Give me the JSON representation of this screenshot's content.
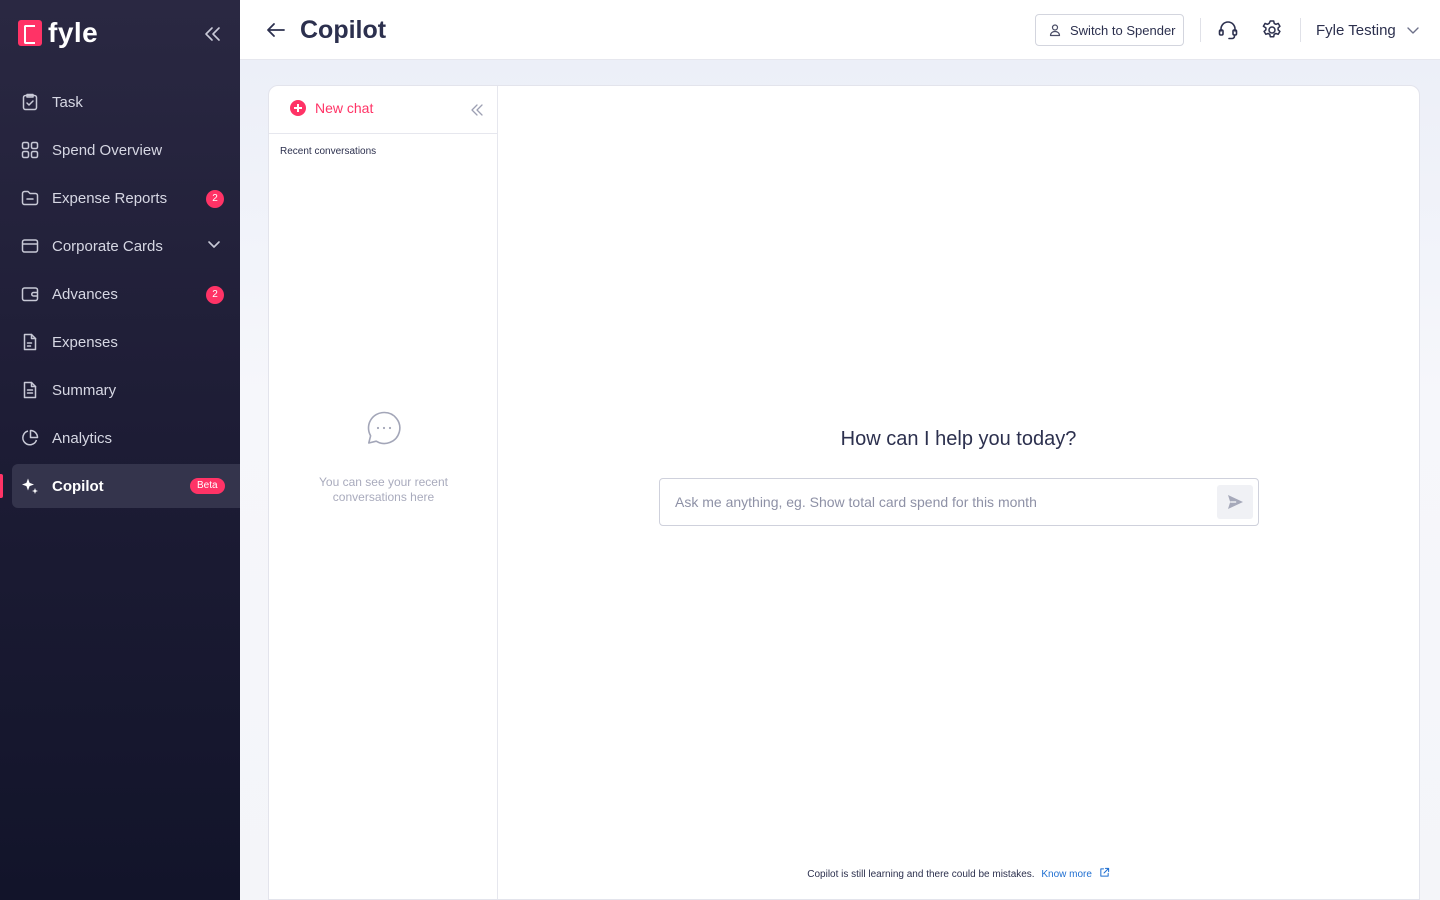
{
  "brand": {
    "name": "fyle",
    "accent": "#ff3366"
  },
  "sidebar": {
    "items": [
      {
        "label": "Task",
        "icon": "task-check-icon"
      },
      {
        "label": "Spend Overview",
        "icon": "grid-icon"
      },
      {
        "label": "Expense Reports",
        "icon": "folder-icon",
        "badge": "2"
      },
      {
        "label": "Corporate Cards",
        "icon": "card-icon"
      },
      {
        "label": "Advances",
        "icon": "wallet-icon",
        "badge": "2"
      },
      {
        "label": "Expenses",
        "icon": "receipt-icon"
      },
      {
        "label": "Summary",
        "icon": "document-icon"
      },
      {
        "label": "Analytics",
        "icon": "pie-chart-icon"
      },
      {
        "label": "Copilot",
        "icon": "sparkle-icon",
        "tag": "Beta"
      }
    ]
  },
  "header": {
    "title": "Copilot",
    "switch_label": "Switch to Spender",
    "user_name": "Fyle Testing"
  },
  "chat_list": {
    "new_chat_label": "New chat",
    "recent_title": "Recent conversations",
    "empty_text": "You can see your recent conversations here"
  },
  "chat": {
    "greeting": "How can I help you today?",
    "placeholder": "Ask me anything, eg. Show total card spend for this month",
    "disclaimer": "Copilot is still learning and there could be mistakes.",
    "know_more": "Know more"
  }
}
